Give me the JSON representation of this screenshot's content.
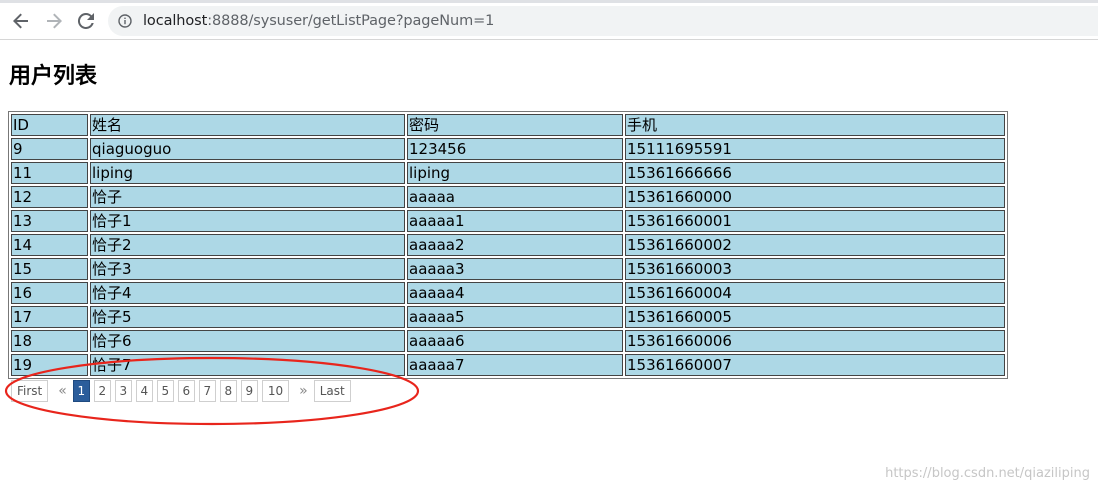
{
  "browser": {
    "url_host": "localhost",
    "url_rest": ":8888/sysuser/getListPage?pageNum=1"
  },
  "page": {
    "title": "用户列表"
  },
  "table": {
    "headers": [
      "ID",
      "姓名",
      "密码",
      "手机"
    ],
    "rows": [
      [
        "9",
        "qiaguoguo",
        "123456",
        "15111695591"
      ],
      [
        "11",
        "liping",
        "liping",
        "15361666666"
      ],
      [
        "12",
        "恰子",
        "aaaaa",
        "15361660000"
      ],
      [
        "13",
        "恰子1",
        "aaaaa1",
        "15361660001"
      ],
      [
        "14",
        "恰子2",
        "aaaaa2",
        "15361660002"
      ],
      [
        "15",
        "恰子3",
        "aaaaa3",
        "15361660003"
      ],
      [
        "16",
        "恰子4",
        "aaaaa4",
        "15361660004"
      ],
      [
        "17",
        "恰子5",
        "aaaaa5",
        "15361660005"
      ],
      [
        "18",
        "恰子6",
        "aaaaa6",
        "15361660006"
      ],
      [
        "19",
        "恰子7",
        "aaaaa7",
        "15361660007"
      ]
    ]
  },
  "pagination": {
    "first_label": "First",
    "prev_label": "«",
    "pages": [
      "1",
      "2",
      "3",
      "4",
      "5",
      "6",
      "7",
      "8",
      "9",
      "10"
    ],
    "active_page": "1",
    "next_label": "»",
    "last_label": "Last"
  },
  "colors": {
    "cell_bg": "#add8e6",
    "active_page_bg": "#2b5d9b",
    "annotation": "#e8251c"
  },
  "watermark": "https://blog.csdn.net/qiaziliping"
}
